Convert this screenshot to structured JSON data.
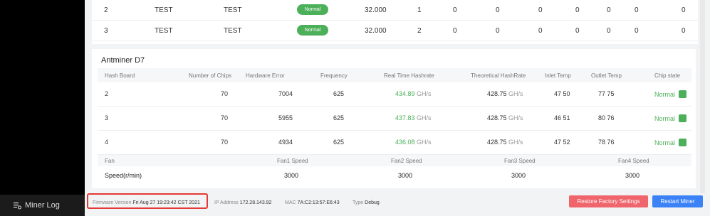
{
  "sidebar": {
    "miner_log_label": "Miner Log",
    "icon": "log-list-icon"
  },
  "top_table": {
    "rows": [
      {
        "chain": "2",
        "type": "TEST",
        "name": "TEST",
        "status": "Normal",
        "freq": "32.000",
        "c1": "1",
        "c2": "0",
        "c3": "0",
        "c4": "0",
        "c5": "0",
        "c6": "0",
        "c7": "0",
        "c8": "0"
      },
      {
        "chain": "3",
        "type": "TEST",
        "name": "TEST",
        "status": "Normal",
        "freq": "32.000",
        "c1": "2",
        "c2": "0",
        "c3": "0",
        "c4": "0",
        "c5": "0",
        "c6": "0",
        "c7": "0",
        "c8": "0"
      }
    ],
    "status_color": "#4cb05a"
  },
  "card": {
    "title": "Antminer D7",
    "headers": {
      "hash_board": "Hash Board",
      "chips": "Number of Chips",
      "hw_error": "Hardware Error",
      "frequency": "Frequency",
      "rt_hashrate": "Real Time Hashrate",
      "th_hashrate": "Theoretical HashRate",
      "inlet": "Inlet Temp",
      "outlet": "Outlet Temp",
      "chip_state": "Chip state"
    },
    "rows": [
      {
        "board": "2",
        "chips": "70",
        "hw_error": "7004",
        "freq": "625",
        "rt_value": "434.89",
        "rt_unit": "GH/s",
        "th_value": "428.75",
        "th_unit": "GH/s",
        "inlet": "47 50",
        "outlet": "77 75",
        "state": "Normal"
      },
      {
        "board": "3",
        "chips": "70",
        "hw_error": "5955",
        "freq": "625",
        "rt_value": "437.83",
        "rt_unit": "GH/s",
        "th_value": "428.75",
        "th_unit": "GH/s",
        "inlet": "46 51",
        "outlet": "80 76",
        "state": "Normal"
      },
      {
        "board": "4",
        "chips": "70",
        "hw_error": "4934",
        "freq": "625",
        "rt_value": "436.08",
        "rt_unit": "GH/s",
        "th_value": "428.75",
        "th_unit": "GH/s",
        "inlet": "47 52",
        "outlet": "78 76",
        "state": "Normal"
      }
    ],
    "fan": {
      "label": "Fan",
      "headers": [
        "Fan1 Speed",
        "Fan2 Speed",
        "Fan3 Speed",
        "Fan4 Speed"
      ],
      "row_label": "Speed(r/min)",
      "values": [
        "3000",
        "3000",
        "3000",
        "3000"
      ]
    }
  },
  "footer": {
    "fw_label": "Firmware Version",
    "fw_value": "Fri Aug 27 19:23:42 CST 2021",
    "ip_label": "IP Address",
    "ip_value": "172.28.143.92",
    "mac_label": "MAC",
    "mac_value": "7A:C2:13:57:E6:43",
    "type_label": "Type",
    "type_value": "Debug",
    "restore_label": "Restore Factory Settings",
    "restart_label": "Restart Miner"
  },
  "colors": {
    "accent_green": "#4cb05a",
    "restore_btn": "#f0646c",
    "restart_btn": "#3b82f6",
    "highlight": "#e53935"
  }
}
